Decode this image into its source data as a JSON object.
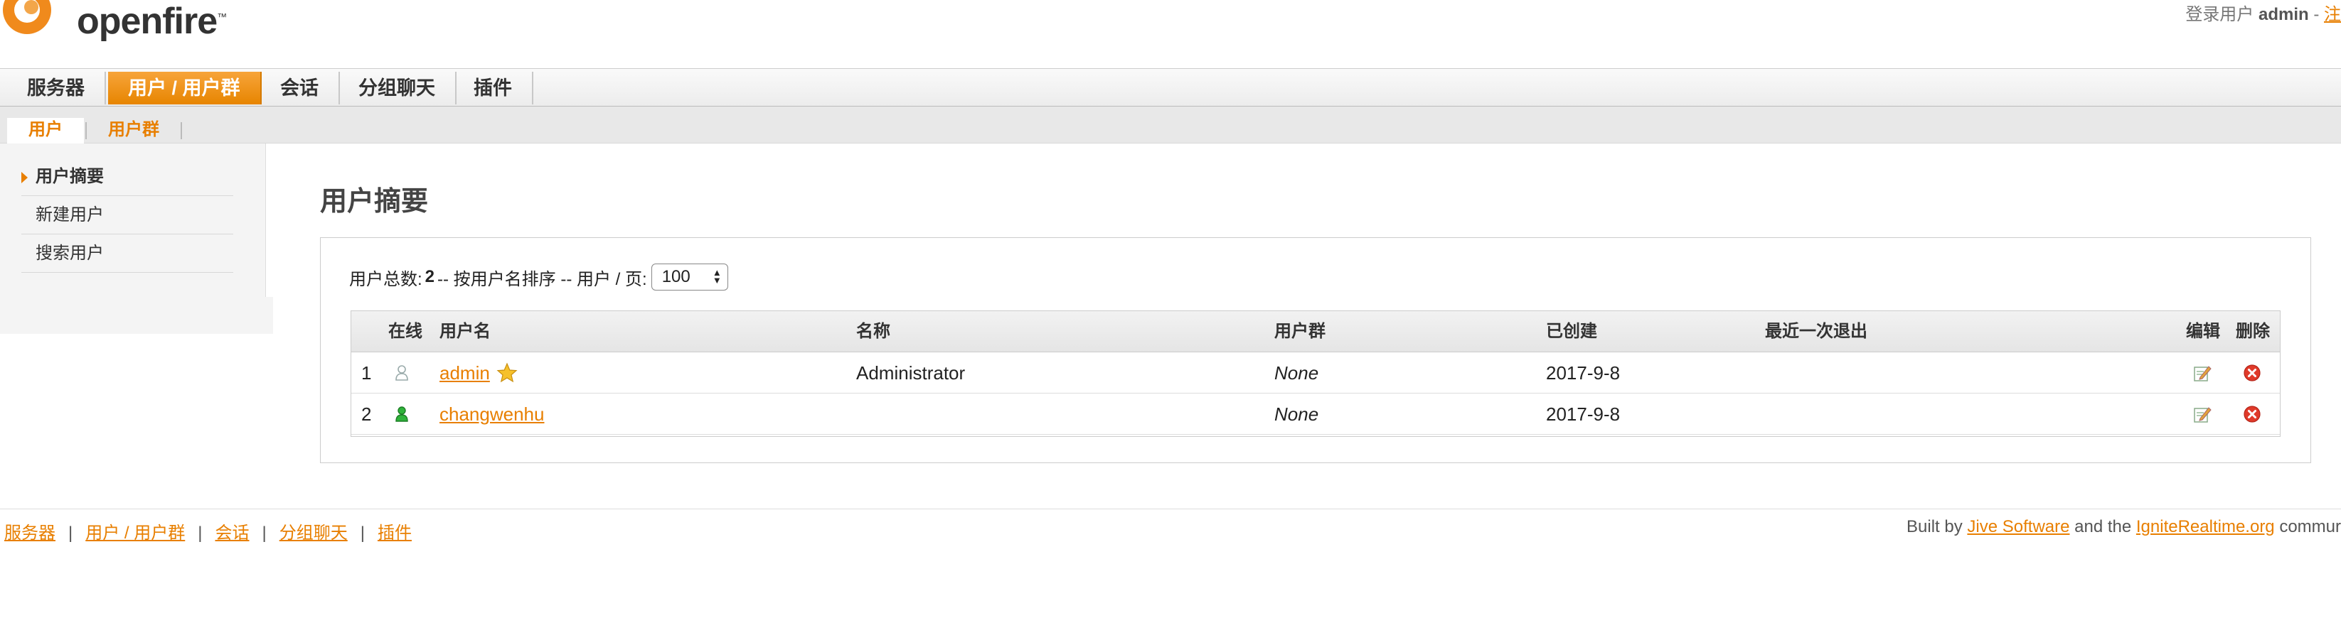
{
  "brand": {
    "name": "openfire",
    "trademark": "™",
    "accent": "#e87f00"
  },
  "user_info": {
    "prefix": "登录用户 ",
    "username": "admin",
    "separator": " - ",
    "logout_label": "注"
  },
  "main_tabs": [
    {
      "label": "服务器",
      "active": false
    },
    {
      "label": "用户 / 用户群",
      "active": true
    },
    {
      "label": "会话",
      "active": false
    },
    {
      "label": "分组聊天",
      "active": false
    },
    {
      "label": "插件",
      "active": false
    }
  ],
  "sub_tabs": [
    {
      "label": "用户",
      "active": true
    },
    {
      "label": "用户群",
      "active": false
    }
  ],
  "sidebar": {
    "items": [
      {
        "label": "用户摘要",
        "active": true
      },
      {
        "label": "新建用户",
        "active": false
      },
      {
        "label": "搜索用户",
        "active": false
      }
    ]
  },
  "page": {
    "title": "用户摘要",
    "summary": {
      "total_label": "用户总数: ",
      "total_value": "2",
      "sort_text": " -- 按用户名排序 -- 用户 / 页: ",
      "per_page": "100"
    }
  },
  "users_table": {
    "columns": [
      "在线",
      "用户名",
      "名称",
      "用户群",
      "已创建",
      "最近一次退出",
      "编辑",
      "删除"
    ],
    "rows": [
      {
        "index": "1",
        "online": false,
        "username": "admin",
        "is_admin": true,
        "name": "Administrator",
        "groups": "None",
        "created": "2017-9-8",
        "last_logout": ""
      },
      {
        "index": "2",
        "online": true,
        "username": "changwenhu",
        "is_admin": false,
        "name": "",
        "groups": "None",
        "created": "2017-9-8",
        "last_logout": ""
      }
    ]
  },
  "footer": {
    "nav": [
      "服务器",
      "用户 / 用户群",
      "会话",
      "分组聊天",
      "插件"
    ],
    "nav_separator": "|",
    "credit": {
      "prefix": "Built by ",
      "link1": "Jive Software",
      "middle": " and the ",
      "link2": "IgniteRealtime.org",
      "suffix": " commur"
    }
  },
  "icons": {
    "online": "user-online-icon",
    "offline": "user-offline-icon",
    "admin": "star-icon",
    "edit": "edit-icon",
    "delete": "delete-icon"
  }
}
